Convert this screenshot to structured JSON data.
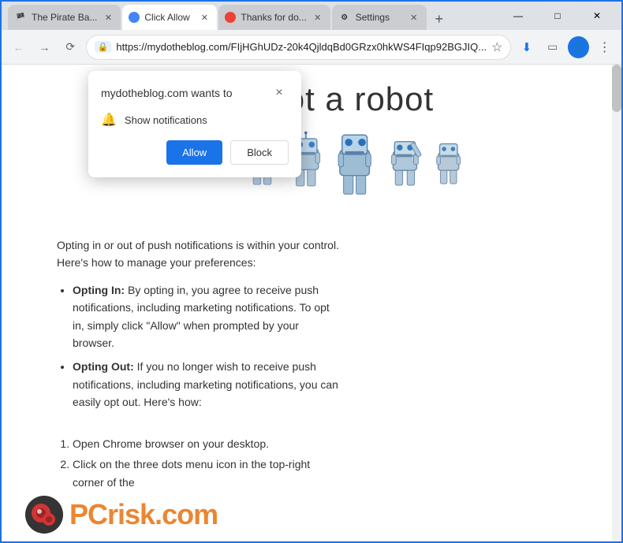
{
  "browser": {
    "tabs": [
      {
        "id": "tab1",
        "title": "The Pirate Ba...",
        "favicon": "🏴",
        "active": false,
        "closeable": true
      },
      {
        "id": "tab2",
        "title": "Click Allow",
        "favicon": "🔵",
        "active": true,
        "closeable": true
      },
      {
        "id": "tab3",
        "title": "Thanks for do...",
        "favicon": "🔴",
        "active": false,
        "closeable": true
      },
      {
        "id": "tab4",
        "title": "Settings",
        "favicon": "⚙",
        "active": false,
        "closeable": true
      }
    ],
    "address": "https://mydotheblog.com/FIjHGhUDz-20k4QjldqBd0GRzx0hkWS4FIqp92BGJIQ...",
    "new_tab_btn": "+",
    "window_controls": {
      "minimize": "—",
      "maximize": "□",
      "close": "✕"
    }
  },
  "notification_popup": {
    "title": "mydotheblog.com wants to",
    "close_btn": "×",
    "notification_label": "Show notifications",
    "allow_btn": "Allow",
    "block_btn": "Block"
  },
  "page": {
    "heading": "are not   a robot",
    "article": {
      "intro": "Opting in or out of push notifications is within your control. Here's how to manage your preferences:",
      "list_items": [
        {
          "title": "Opting In:",
          "text": "By opting in, you agree to receive push notifications, including marketing notifications. To opt in, simply click \"Allow\" when prompted by your browser."
        },
        {
          "title": "Opting Out:",
          "text": "If you no longer wish to receive push notifications, including marketing notifications, you can easily opt out. Here's how:"
        }
      ],
      "steps": [
        "Open Chrome browser on your desktop.",
        "Click on the three dots menu icon in the top-right corner of the"
      ]
    },
    "logo_text": "PC",
    "logo_colored": "risk",
    "logo_suffix": ".com"
  }
}
